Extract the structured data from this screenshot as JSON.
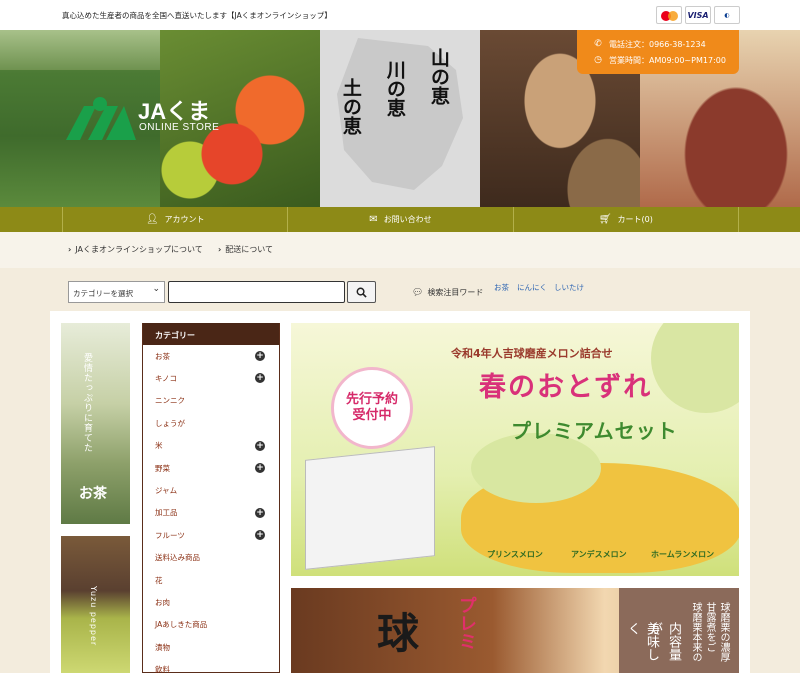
{
  "header": {
    "tagline": "真心込めた生産者の商品を全国へ直送いたします【JAくまオンラインショップ】",
    "payment_cards": [
      "MasterCard",
      "VISA",
      "Diners"
    ]
  },
  "hero": {
    "logo_name": "JAくま",
    "logo_sub": "ONLINE STORE",
    "map_text": [
      "山の恵",
      "川の恵",
      "土の恵"
    ],
    "contact_phone": "電話注文：0966-38-1234",
    "contact_hours": "営業時間：AM09:00~PM17:00"
  },
  "nav": {
    "account": "アカウント",
    "contact": "お問い合わせ",
    "cart": "カート(0)"
  },
  "subnav": {
    "about": "JAくまオンラインショップについて",
    "shipping": "配送について"
  },
  "search": {
    "category_placeholder": "カテゴリーを選択",
    "hot_label": "検索注目ワード",
    "hot_words": [
      "お茶",
      "にんにく",
      "しいたけ"
    ]
  },
  "side": {
    "pic1_vertical": "愛情たっぷりに育てた",
    "pic1_title": "お茶",
    "pic2_vertical": "Yuzu pepper"
  },
  "category": {
    "title": "カテゴリー",
    "items": [
      {
        "label": "お茶",
        "expand": true
      },
      {
        "label": "キノコ",
        "expand": true
      },
      {
        "label": "ニンニク",
        "expand": false
      },
      {
        "label": "しょうが",
        "expand": false
      },
      {
        "label": "米",
        "expand": true
      },
      {
        "label": "野菜",
        "expand": true
      },
      {
        "label": "ジャム",
        "expand": false
      },
      {
        "label": "加工品",
        "expand": true
      },
      {
        "label": "フルーツ",
        "expand": true
      },
      {
        "label": "送料込み商品",
        "expand": false
      },
      {
        "label": "花",
        "expand": false
      },
      {
        "label": "お肉",
        "expand": false
      },
      {
        "label": "JAあしきた商品",
        "expand": false
      },
      {
        "label": "漬物",
        "expand": false
      },
      {
        "label": "飲料",
        "expand": false
      }
    ]
  },
  "banner1": {
    "preorder": "先行予約",
    "accepting": "受付中",
    "subtitle": "令和4年人吉球磨産メロン詰合せ",
    "title": "春のおとずれ",
    "title2": "プレミアムセット",
    "labels": [
      "プリンスメロン",
      "アンデスメロン",
      "ホームランメロン"
    ]
  },
  "banner2": {
    "big": "球",
    "pink": "プレミ",
    "panel_text": [
      "球磨栗の濃厚",
      "甘露煮をご",
      "球磨栗本来の",
      "内容量が",
      "美味しく"
    ]
  },
  "colors": {
    "nav_olive": "#8d8a17",
    "contact_orange": "#f08a1a",
    "category_brown": "#4a2616",
    "link_blue": "#2f66b3"
  }
}
